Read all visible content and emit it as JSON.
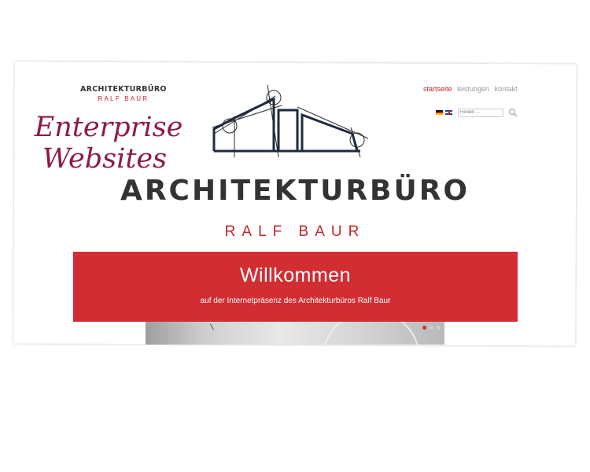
{
  "overlay": {
    "line1": "Enterprise",
    "line2": "Websites"
  },
  "logo_small": {
    "line1": "ARCHITEKTURBÜRO",
    "line2": "RALF BAUR"
  },
  "nav": {
    "items": [
      "startseite",
      "leistungen",
      "kontakt"
    ],
    "active": "startseite"
  },
  "search": {
    "placeholder": "Finden ..."
  },
  "languages": [
    "de-flag-icon",
    "en-flag-icon"
  ],
  "logo_big": {
    "title": "ARCHITEKTURBÜRO",
    "subtitle": "RALF BAUR"
  },
  "hero": {
    "heading": "Willkommen",
    "text": "auf der Internetpräsenz des Architekturbüros Ralf Baur"
  },
  "slider": {
    "total": 3,
    "active_index": 0
  },
  "colors": {
    "accent": "#d12d33",
    "overlay_text": "#8d1a4b",
    "logo_text": "#333333"
  }
}
